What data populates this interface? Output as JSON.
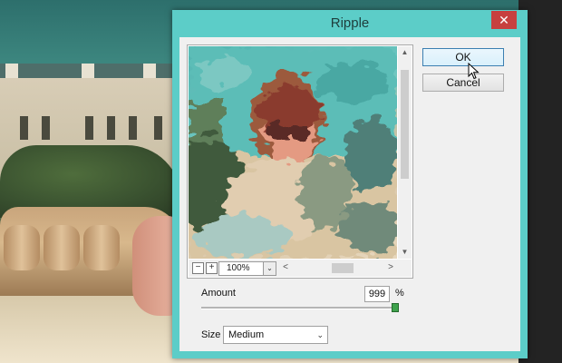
{
  "dialog": {
    "title": "Ripple",
    "close_glyph": "✕"
  },
  "preview": {
    "zoom_out_glyph": "−",
    "zoom_in_glyph": "+",
    "zoom_value": "100%",
    "dropdown_glyph": "⌄",
    "scroll_up_glyph": "▲",
    "scroll_down_glyph": "▼",
    "scroll_left_glyph": "<",
    "scroll_right_glyph": ">"
  },
  "buttons": {
    "ok_label": "OK",
    "cancel_label": "Cancel"
  },
  "amount": {
    "label": "Amount",
    "value": "999",
    "unit": "%",
    "slider_level_fraction": 1.0
  },
  "size": {
    "label": "Size",
    "selected": "Medium",
    "chevron_glyph": "⌄"
  },
  "colors": {
    "window_frame": "#5ccdc8",
    "close_button": "#c7403f",
    "default_button_border": "#3c7fb1"
  }
}
